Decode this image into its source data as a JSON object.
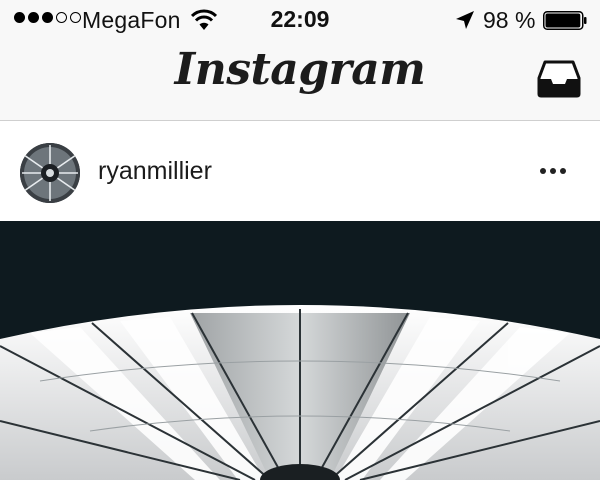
{
  "status_bar": {
    "signal_strength": {
      "filled": 3,
      "total": 5
    },
    "carrier": "MegaFon",
    "wifi_icon": "wifi-icon",
    "time": "22:09",
    "location_icon": "location-arrow-icon",
    "battery_percent": "98 %",
    "battery_level": 0.98
  },
  "nav": {
    "logo": "Instagram",
    "inbox_icon": "inbox-icon"
  },
  "post": {
    "username": "ryanmillier",
    "avatar_icon": "avatar",
    "more_icon": "more-horizontal-icon"
  },
  "colors": {
    "bar_background": "#f8f8f8",
    "photo_dark": "#0e1a1f",
    "text": "#111111"
  }
}
